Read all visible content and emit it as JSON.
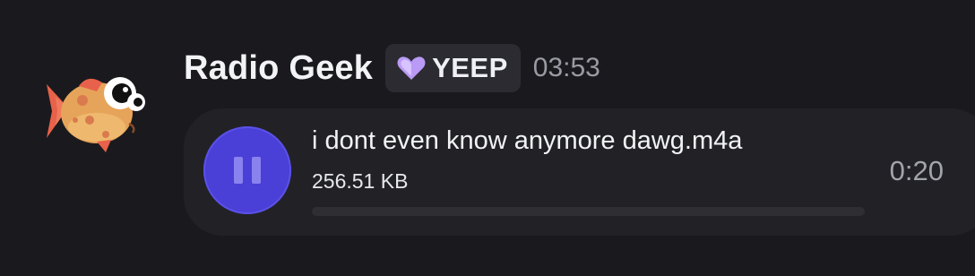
{
  "message": {
    "author": "Radio Geek",
    "tag": {
      "icon": "purple-heart-icon",
      "label": "YEEP"
    },
    "timestamp": "03:53"
  },
  "attachment": {
    "file_name": "i dont even know anymore dawg.m4a",
    "file_size": "256.51 KB",
    "duration": "0:20",
    "state": "playing",
    "control_icon": "pause-icon",
    "progress": 0.0
  },
  "colors": {
    "background": "#1a1a1e",
    "card": "#222226",
    "accent": "#4a3fd6",
    "tag_heart": "#b99af5"
  }
}
